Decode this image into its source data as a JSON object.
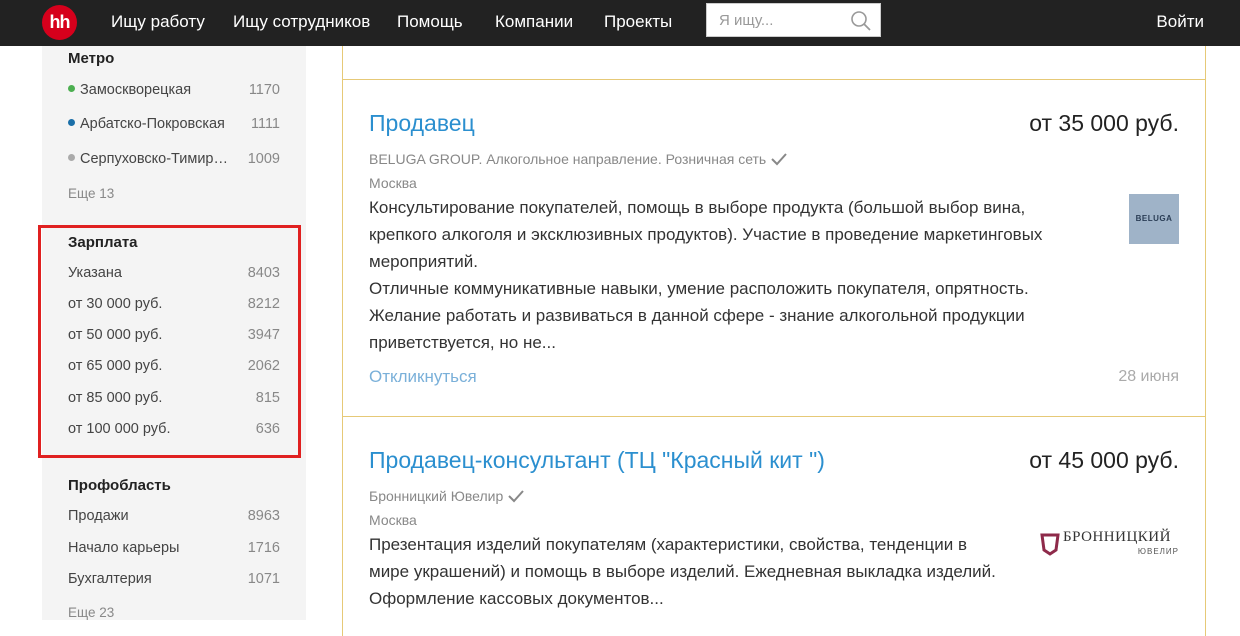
{
  "header": {
    "logo": "hh",
    "nav": [
      "Ищу работу",
      "Ищу сотрудников",
      "Помощь",
      "Компании",
      "Проекты"
    ],
    "search_placeholder": "Я ищу...",
    "login": "Войти"
  },
  "sidebar": {
    "metro": {
      "title": "Метро",
      "items": [
        {
          "label": "Замоскворецкая",
          "count": "1170",
          "color": "#4caf50"
        },
        {
          "label": "Арбатско-Покровская",
          "count": "1111",
          "color": "#1a6fa8"
        },
        {
          "label": "Серпуховско-Тимир…",
          "count": "1009",
          "color": "#aaaaaa"
        }
      ],
      "more": "Еще 13"
    },
    "salary": {
      "title": "Зарплата",
      "items": [
        {
          "label": "Указана",
          "count": "8403"
        },
        {
          "label": "от 30 000 руб.",
          "count": "8212"
        },
        {
          "label": "от 50 000 руб.",
          "count": "3947"
        },
        {
          "label": "от 65 000 руб.",
          "count": "2062"
        },
        {
          "label": "от 85 000 руб.",
          "count": "815"
        },
        {
          "label": "от 100 000 руб.",
          "count": "636"
        }
      ]
    },
    "prof": {
      "title": "Профобласть",
      "items": [
        {
          "label": "Продажи",
          "count": "8963"
        },
        {
          "label": "Начало карьеры",
          "count": "1716"
        },
        {
          "label": "Бухгалтерия",
          "count": "1071"
        }
      ],
      "more": "Еще 23"
    }
  },
  "vacancies": [
    {
      "title": "Продавец",
      "salary": "от 35 000 руб.",
      "company": "BELUGA GROUP. Алкогольное направление. Розничная сеть",
      "city": "Москва",
      "description": [
        "Консультирование покупателей, помощь в выборе продукта (большой выбор вина,",
        "крепкого алкоголя и эксклюзивных продуктов). Участие в проведение маркетинговых",
        "мероприятий.",
        "Отличные коммуникативные навыки, умение расположить покупателя, опрятность.",
        "Желание работать и развиваться в данной сфере - знание алкогольной продукции",
        "приветствуется, но не..."
      ],
      "respond": "Откликнуться",
      "date": "28 июня",
      "logo_text": "BELUGA"
    },
    {
      "title": "Продавец-консультант (ТЦ \"Красный кит \")",
      "salary": "от 45 000 руб.",
      "company": "Бронницкий Ювелир",
      "city": "Москва",
      "description": [
        "Презентация изделий покупателям (характеристики, свойства, тенденции в",
        "мире украшений) и помощь в выборе изделий. Ежедневная выкладка изделий.",
        "Оформление кассовых документов..."
      ],
      "logo_text": "БРОННИЦКИЙ",
      "logo_subtext": "ЮВЕЛИР"
    }
  ]
}
